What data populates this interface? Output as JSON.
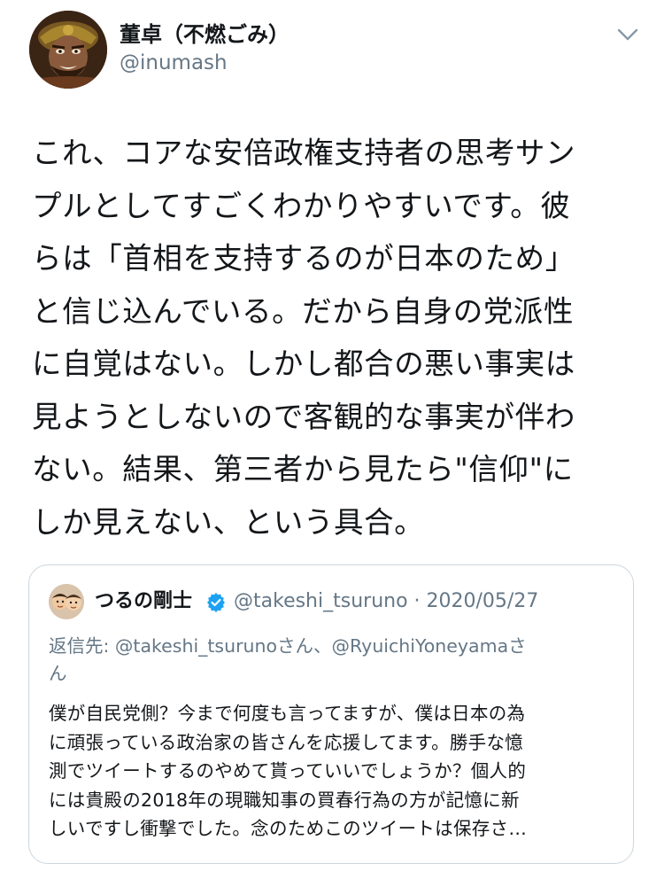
{
  "author": {
    "display_name": "董卓（不燃ごみ）",
    "handle": "@inumash"
  },
  "tweet": {
    "lines": [
      "これ、コアな安倍政権支持者の思考サン",
      "プルとしてすごくわかりやすいです。彼",
      "らは「首相を支持するのが日本のため」",
      "と信じ込んでいる。だから自身の党派性",
      "に自覚はない。しかし都合の悪い事実は",
      "見ようとしないので客観的な事実が伴わ",
      "ない。結果、第三者から見たら\"信仰\"に",
      "しか見えない、という具合。"
    ]
  },
  "quoted_tweet": {
    "display_name": "つるの剛士",
    "verified": true,
    "meta": "@takeshi_tsuruno · 2020/05/27",
    "reply_to": {
      "lines": [
        "返信先: @takeshi_tsurunoさん、@RyuichiYoneyamaさ",
        "ん"
      ]
    },
    "lines": [
      "僕が自民党側？今まで何度も言ってますが、僕は日本の為",
      "に頑張っている政治家の皆さんを応援してます。勝手な憶",
      "測でツイートするのやめて貰っていいでしょうか？個人的",
      "には貴殿の2018年の現職知事の買春行為の方が記憶に新",
      "しいですし衝撃でした。念のためこのツイートは保存さ…"
    ]
  },
  "icons": {
    "menu": "chevron-down-icon",
    "verified": "verified-badge-icon"
  },
  "colors": {
    "text": "#14171a",
    "secondary": "#657786",
    "border": "#ccd6dd",
    "verified": "#1da1f2"
  }
}
